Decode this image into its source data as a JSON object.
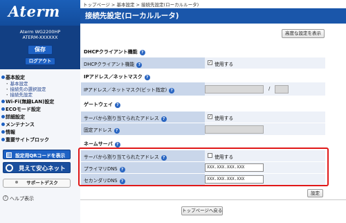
{
  "logo": "Aterm",
  "device": {
    "model": "Aterm WG2200HP",
    "name": "ATERM-XXXXXX"
  },
  "buttons": {
    "save": "保存",
    "logout": "ログアウト"
  },
  "menu": {
    "basic": "基本設定",
    "basic_sub": [
      "基本設定",
      "接続先の選択設定",
      "接続先設定"
    ],
    "wifi": "Wi-Fi(無線LAN)設定",
    "eco": "ECOモード設定",
    "detail": "詳細設定",
    "maintenance": "メンテナンス",
    "info": "情報",
    "sitemap": "重要サイトブロック"
  },
  "side_buttons": {
    "qr": "設定用QRコードを表示",
    "mieru": "見えて安心ネット",
    "support": "サポートデスク",
    "help": "ヘルプ表示"
  },
  "breadcrumb": "トップページ > 基本設定 > 接続先設定(ローカルルータ)",
  "page_title": "接続先設定(ローカルルータ)",
  "advanced_button": "高度な設定を表示",
  "sections": {
    "dhcp": {
      "title": "DHCPクライアント機能",
      "row_label": "DHCPクライアント機能",
      "checkbox_label": "使用する",
      "checked": true
    },
    "ip": {
      "title": "IPアドレス／ネットマスク",
      "row_label": "IPアドレス／ネットマスク(ビット指定)",
      "separator": "/",
      "ip_value": "",
      "mask_value": ""
    },
    "gateway": {
      "title": "ゲートウェイ",
      "auto_label": "サーバから割り当てられたアドレス",
      "auto_checkbox": "使用する",
      "auto_checked": true,
      "fixed_label": "固定アドレス",
      "fixed_value": ""
    },
    "dns": {
      "title": "ネームサーバ",
      "auto_label": "サーバから割り当てられたアドレス",
      "auto_checkbox": "使用する",
      "auto_checked": false,
      "primary_label": "プライマリDNS",
      "primary_value": "XXX.XXX.XXX.XXX",
      "secondary_label": "セカンダリDNS",
      "secondary_value": "XXX.XXX.XXX.XXX"
    }
  },
  "set_button": "設定",
  "back_button": "トップページへ戻る",
  "colors": {
    "brand_blue": "#1a56aa",
    "row_bg": "#c9d6ea",
    "highlight": "#e01818"
  },
  "icons": {
    "help": "question-circle-icon",
    "qr": "qr-code-icon",
    "mieru": "magnifier-icon"
  }
}
